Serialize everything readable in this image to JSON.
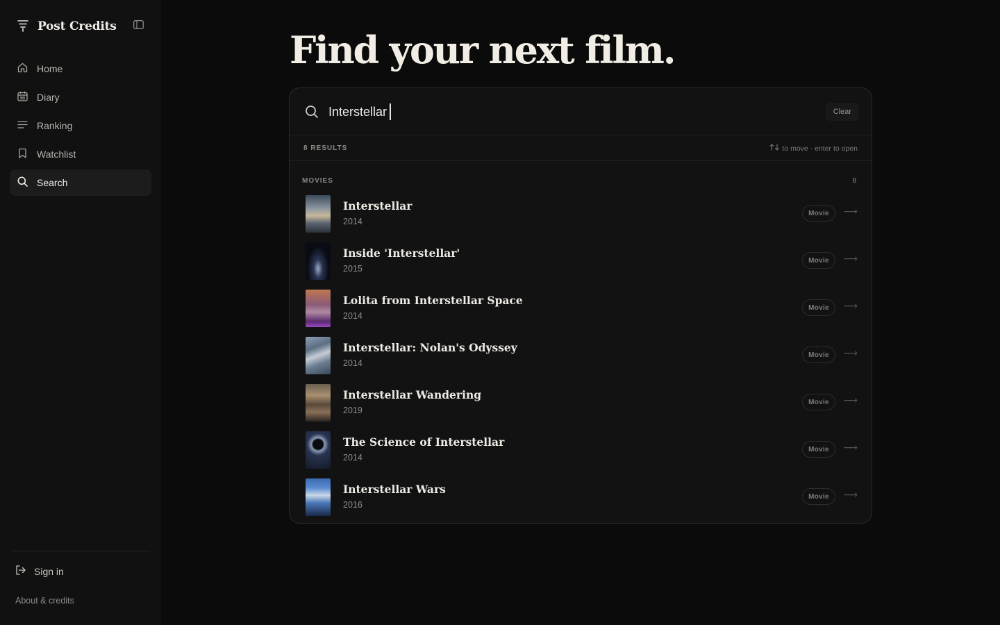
{
  "app": {
    "name": "Post Credits"
  },
  "sidebar": {
    "items": [
      {
        "label": "Home",
        "icon": "home-icon"
      },
      {
        "label": "Diary",
        "icon": "calendar-icon"
      },
      {
        "label": "Ranking",
        "icon": "list-icon"
      },
      {
        "label": "Watchlist",
        "icon": "bookmark-icon"
      },
      {
        "label": "Search",
        "icon": "search-icon",
        "active": true
      }
    ],
    "sign_in": "Sign in",
    "about": "About & credits"
  },
  "main": {
    "headline": "Find your next film.",
    "search": {
      "value": "Interstellar",
      "clear_label": "Clear"
    },
    "results": {
      "count_label": "8 RESULTS",
      "hint": "to move · enter to open",
      "section_label": "MOVIES",
      "section_count": "8",
      "items": [
        {
          "title": "Interstellar",
          "year": "2014",
          "type": "Movie"
        },
        {
          "title": "Inside 'Interstellar'",
          "year": "2015",
          "type": "Movie"
        },
        {
          "title": "Lolita from Interstellar Space",
          "year": "2014",
          "type": "Movie"
        },
        {
          "title": "Interstellar: Nolan's Odyssey",
          "year": "2014",
          "type": "Movie"
        },
        {
          "title": "Interstellar Wandering",
          "year": "2019",
          "type": "Movie"
        },
        {
          "title": "The Science of Interstellar",
          "year": "2014",
          "type": "Movie"
        },
        {
          "title": "Interstellar Wars",
          "year": "2016",
          "type": "Movie"
        }
      ]
    }
  },
  "colors": {
    "background": "#0b0b0b",
    "sidebar": "#111111",
    "panel": "#121213",
    "text": "#e9e6df"
  }
}
